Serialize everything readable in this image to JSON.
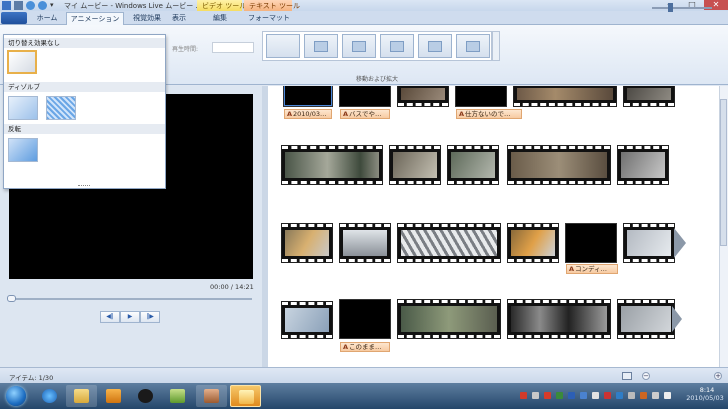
{
  "window": {
    "title": "マイ ムービー - Windows Live ムービー …",
    "context_tabs": [
      "ビデオ ツール",
      "テキスト ツール"
    ],
    "controls": {
      "minimize": "─",
      "maximize": "□",
      "close": "✕"
    }
  },
  "ribbon": {
    "tabs": [
      "ホーム",
      "アニメーション",
      "視覚効果",
      "表示",
      "編集",
      "フォーマット"
    ],
    "active_tab": "アニメーション",
    "duration_label": "再生時間:",
    "group_label": "移動および拡大"
  },
  "transitions_panel": {
    "sections": [
      "切り替え効果なし",
      "ディゾルブ",
      "反転"
    ]
  },
  "preview": {
    "time": "00:00 / 14:21",
    "controls": [
      "◀‖",
      "▶",
      "‖▶"
    ]
  },
  "storyboard": {
    "captions": [
      "2010/03…",
      "バスでや…",
      "仕方ないので…",
      "コンディ…",
      "このまま…"
    ]
  },
  "status": {
    "items": "アイテム: 1/30",
    "zoom_minus": "−",
    "zoom_plus": "+"
  },
  "taskbar": {
    "time": "8:14",
    "date": "2010/05/03"
  },
  "colors": {
    "caption_bg": "#f7caa1",
    "video_tools": "#f6dd62",
    "text_tools": "#f5b27f",
    "taskbar": "#24466a"
  }
}
